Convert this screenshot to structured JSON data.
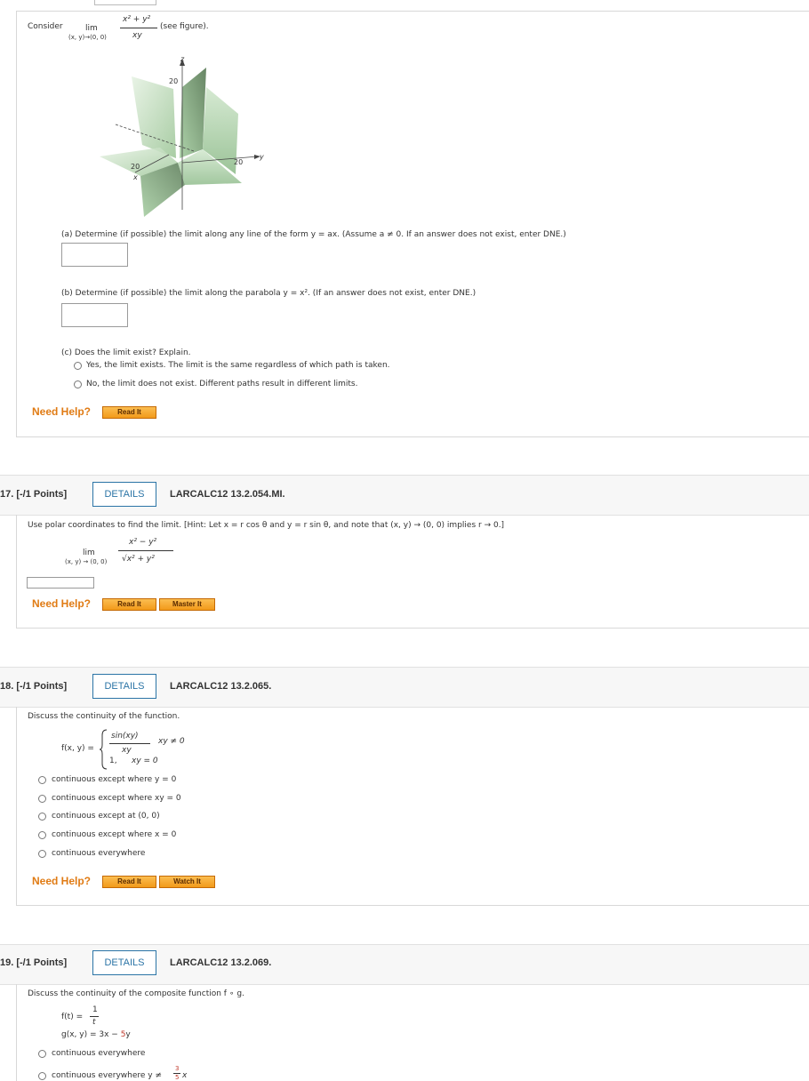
{
  "top_card": {
    "consider": "Consider",
    "lim": "lim",
    "lim_sub": "(x, y)→(0, 0)",
    "numerator": "x² + y²",
    "denominator": "xy",
    "see_figure": "(see figure).",
    "figure": {
      "z_label": "z",
      "y_label": "y",
      "x_label": "x",
      "z_tick": "20",
      "y_tick": "20",
      "x_tick": "20"
    },
    "part_a": "(a) Determine (if possible) the limit along any line of the form y = ax. (Assume a ≠ 0. If an answer does not exist, enter DNE.)",
    "part_b": "(b) Determine (if possible) the limit along the parabola y = x². (If an answer does not exist, enter DNE.)",
    "part_c": "(c) Does the limit exist? Explain.",
    "options": [
      "Yes, the limit exists. The limit is the same regardless of which path is taken.",
      "No, the limit does not exist. Different paths result in different limits."
    ],
    "need_help": "Need Help?",
    "read_it": "Read It"
  },
  "q17": {
    "number": "17. [-/1 Points]",
    "details": "DETAILS",
    "code": "LARCALC12 13.2.054.MI.",
    "prompt": "Use polar coordinates to find the limit. [Hint: Let x = r cos θ and y = r sin θ, and note that (x, y) → (0, 0) implies r → 0.]",
    "lim": "lim",
    "lim_sub": "(x, y) → (0, 0)",
    "numerator": "x² − y²",
    "denominator": "√x² + y²",
    "need_help": "Need Help?",
    "read_it": "Read It",
    "master_it": "Master It"
  },
  "q18": {
    "number": "18. [-/1 Points]",
    "details": "DETAILS",
    "code": "LARCALC12 13.2.065.",
    "prompt": "Discuss the continuity of the function.",
    "fx": "f(x, y) =",
    "case1_num": "sin(xy)",
    "case1_den": "xy",
    "case1_cond": "xy ≠ 0",
    "case2_val": "1,",
    "case2_cond": "xy = 0",
    "options": [
      "continuous except where y = 0",
      "continuous except where xy = 0",
      "continuous except at (0, 0)",
      "continuous except where x = 0",
      "continuous everywhere"
    ],
    "need_help": "Need Help?",
    "read_it": "Read It",
    "watch_it": "Watch It"
  },
  "q19": {
    "number": "19. [-/1 Points]",
    "details": "DETAILS",
    "code": "LARCALC12 13.2.069.",
    "prompt": "Discuss the continuity of the composite function f ∘ g.",
    "ft": "f(t) =",
    "ft_num": "1",
    "ft_den": "t",
    "g_prefix": "g(x, y) = 3x − ",
    "g_red": "5",
    "g_suffix": "y",
    "options": [
      "continuous everywhere",
      "continuous everywhere y ≠"
    ],
    "opt2_frac_num": "3",
    "opt2_frac_den": "5",
    "opt2_tail": "x"
  }
}
